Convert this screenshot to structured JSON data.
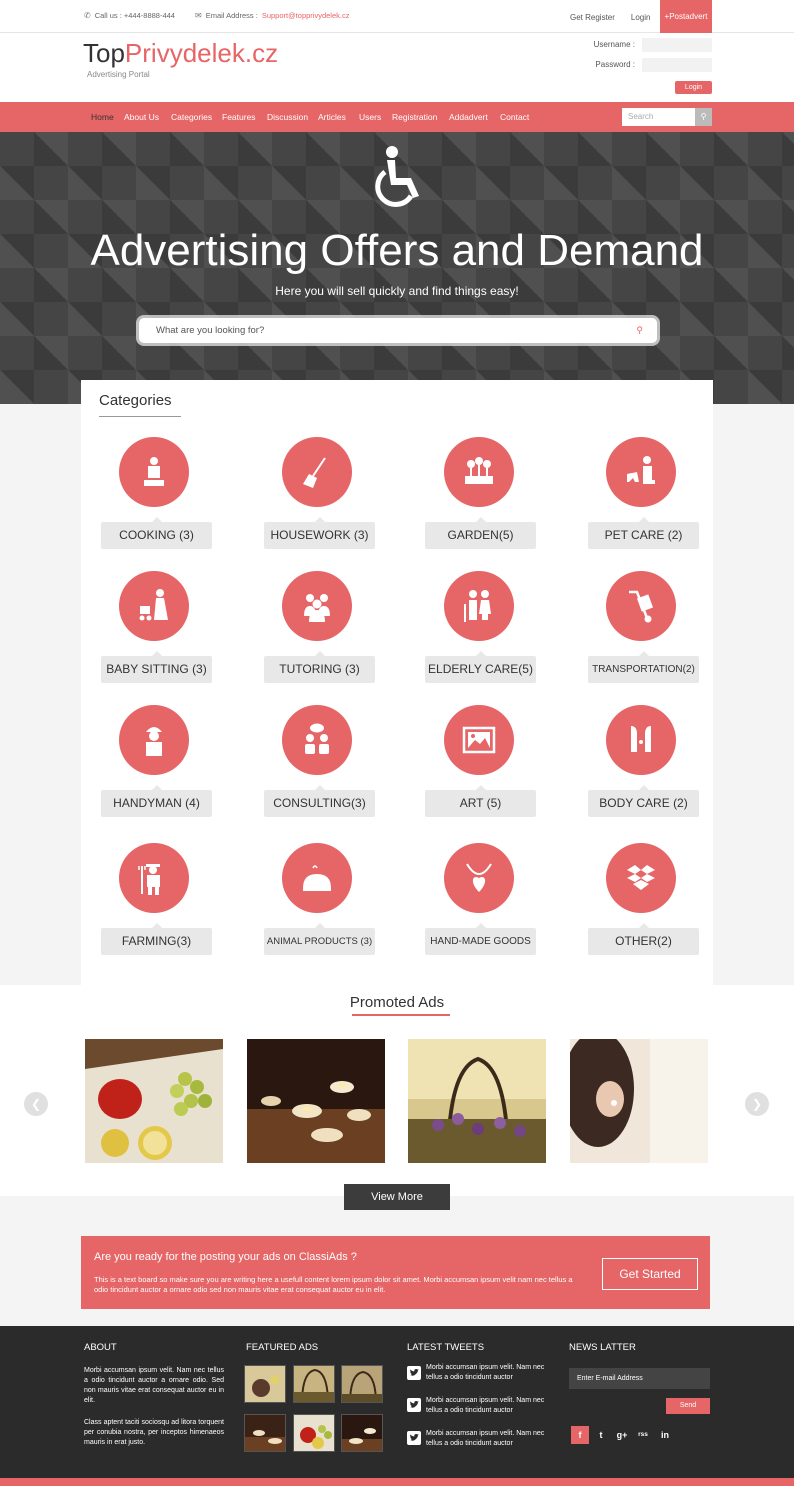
{
  "colors": {
    "accent": "#e66567",
    "dark": "#2b2b2b"
  },
  "topbar": {
    "call_label": "Call us : +444-8888-444",
    "email_label": "Email Address :",
    "email": "Support@topprivydelek.cz",
    "get_register": "Get Register",
    "login": "Login",
    "postadvert": "+Postadvert"
  },
  "header": {
    "logo_part1": "Top",
    "logo_part2": "Privydelek.cz",
    "tagline": "Advertising Portal",
    "username_label": "Username :",
    "password_label": "Password :",
    "login_button": "Login"
  },
  "nav": {
    "items": [
      "Home",
      "About Us",
      "Categories",
      "Features",
      "Discussion",
      "Articles",
      "Users",
      "Registration",
      "Addadvert",
      "Contact"
    ],
    "search_placeholder": "Search"
  },
  "hero": {
    "icon": "wheelchair-icon",
    "title": "Advertising Offers and Demand",
    "subtitle": "Here you will sell quickly and find things easy!",
    "search_placeholder": "What are you looking for?"
  },
  "categories": {
    "title": "Categories",
    "items": [
      {
        "label": "COOKING (3)",
        "icon": "chef-icon"
      },
      {
        "label": "HOUSEWORK (3)",
        "icon": "broom-icon"
      },
      {
        "label": "GARDEN(5)",
        "icon": "flowers-icon"
      },
      {
        "label": "PET CARE  (2)",
        "icon": "pet-icon"
      },
      {
        "label": "BABY SITTING  (3)",
        "icon": "stroller-icon"
      },
      {
        "label": "TUTORING (3)",
        "icon": "group-icon"
      },
      {
        "label": "ELDERLY CARE(5)",
        "icon": "elderly-icon"
      },
      {
        "label": "TRANSPORTATION(2)",
        "icon": "hand-truck-icon"
      },
      {
        "label": "HANDYMAN (4)",
        "icon": "worker-icon"
      },
      {
        "label": "CONSULTING(3)",
        "icon": "consulting-icon"
      },
      {
        "label": "ART (5)",
        "icon": "picture-icon"
      },
      {
        "label": "BODY CARE (2)",
        "icon": "bodycare-icon"
      },
      {
        "label": "FARMING(3)",
        "icon": "farmer-icon"
      },
      {
        "label": "ANIMAL PRODUCTS (3)",
        "icon": "chicken-icon"
      },
      {
        "label": "HAND-MADE GOODS",
        "icon": "necklace-icon"
      },
      {
        "label": "OTHER(2)",
        "icon": "box-icon"
      }
    ]
  },
  "promoted": {
    "title": "Promoted Ads",
    "view_more": "View More"
  },
  "cta": {
    "title": "Are you ready for the posting your ads on ClassiAds ?",
    "body": "This is a text board so make sure you are writing here a usefull content lorem ipsum dolor sit amet. Morbi accumsan ipsum velit nam nec tellus a odio tincidunt auctor a ornare odio sed non mauris vitae erat consequat auctor eu in elit.",
    "button": "Get Started"
  },
  "footer": {
    "about_title": "ABOUT",
    "about_p1": "Morbi accumsan ipsum velit. Nam nec tellus a odio tincidunt auctor a ornare odio. Sed non mauris vitae erat consequat auctor eu in elit.",
    "about_p2": "Class aptent taciti sociosqu ad litora torquent per conubia nostra, per inceptos himenaeos mauris in erat justo.",
    "featured_title": "FEATURED ADS",
    "tweets_title": "LATEST TWEETS",
    "tweets": [
      "Morbi accumsan ipsum velit. Nam nec tellus a odio tincidunt auctor",
      "Morbi accumsan ipsum velit. Nam nec tellus a odio tincidunt auctor",
      "Morbi accumsan ipsum velit. Nam nec tellus a odio tincidunt auctor"
    ],
    "newsletter_title": "NEWS LATTER",
    "newsletter_placeholder": "Enter E-mail Address",
    "send": "Send",
    "social": [
      "f",
      "t",
      "g+",
      "rss",
      "in"
    ]
  }
}
